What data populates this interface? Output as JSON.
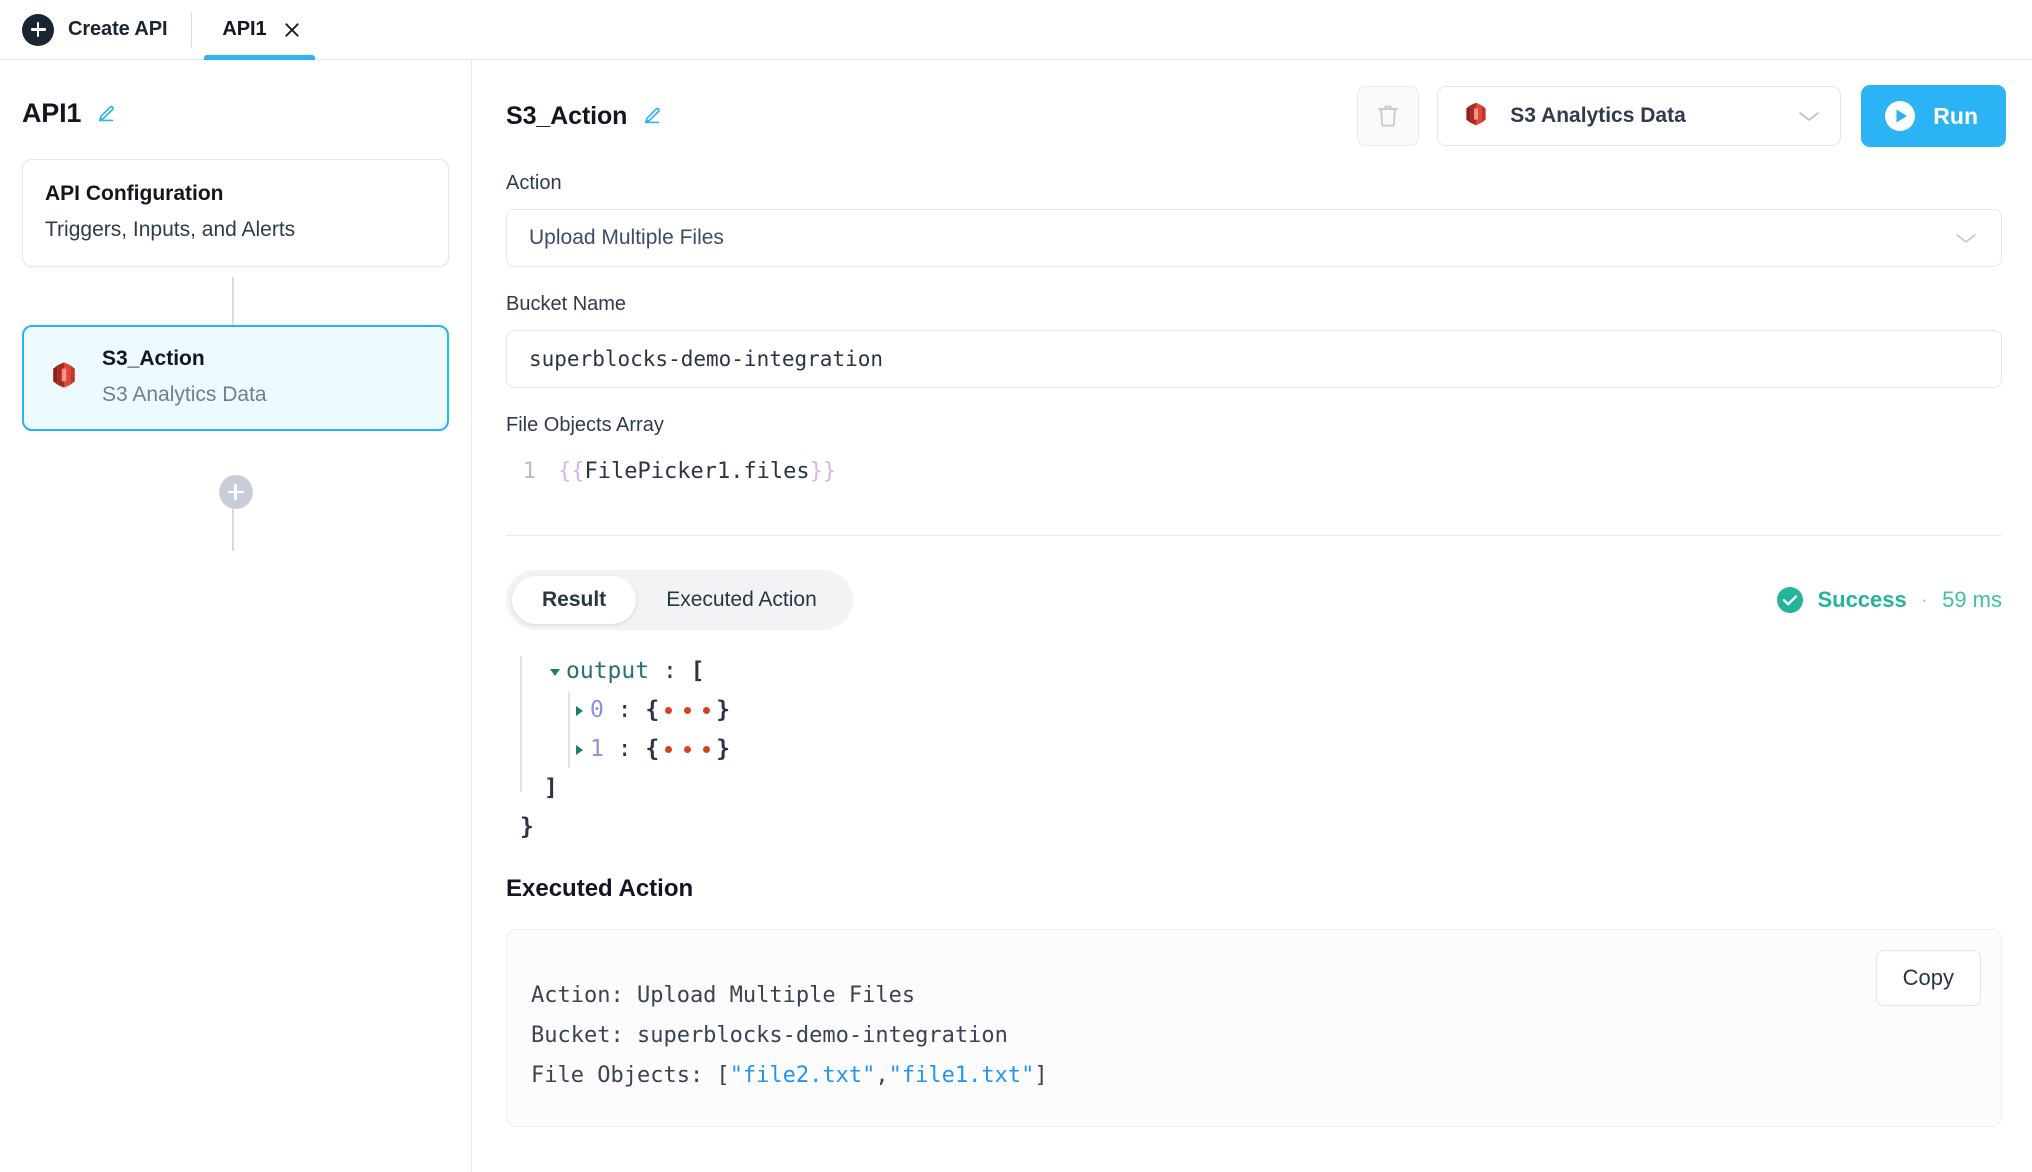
{
  "topbar": {
    "create_api_label": "Create API",
    "plus_icon": "plus-icon",
    "tabs": [
      {
        "label": "API1",
        "active": true,
        "close_icon": "close-icon"
      }
    ]
  },
  "sidebar": {
    "api_name": "API1",
    "edit_icon": "pencil-icon",
    "nodes": [
      {
        "title": "API Configuration",
        "subtitle": "Triggers, Inputs, and Alerts",
        "selected": false,
        "icon": null
      },
      {
        "title": "S3_Action",
        "subtitle": "S3 Analytics Data",
        "selected": true,
        "icon": "s3-icon"
      }
    ],
    "add_step_icon": "plus-icon"
  },
  "main": {
    "header": {
      "title": "S3_Action",
      "edit_icon": "pencil-icon",
      "delete_icon": "trash-icon",
      "integration": {
        "icon": "s3-icon",
        "name": "S3 Analytics Data",
        "chevron_icon": "chevron-down-icon"
      },
      "run": {
        "label": "Run",
        "icon": "play-icon",
        "color": "#2bb3f3"
      }
    },
    "form": {
      "action": {
        "label": "Action",
        "value": "Upload Multiple Files",
        "chevron_icon": "chevron-down-icon"
      },
      "bucket": {
        "label": "Bucket Name",
        "value": "superblocks-demo-integration"
      },
      "file_objects_array": {
        "label": "File Objects Array",
        "line_number": "1",
        "open_brace": "{{",
        "expression": "FilePicker1.files",
        "close_brace": "}}"
      }
    },
    "results": {
      "tabs": [
        {
          "label": "Result",
          "active": true
        },
        {
          "label": "Executed Action",
          "active": false
        }
      ],
      "status": {
        "icon": "check-circle-icon",
        "text": "Success",
        "separator": "·",
        "duration": "59 ms",
        "color": "#23b597"
      },
      "json": {
        "root_open": "",
        "rows": [
          {
            "indent": 0,
            "caret": "expanded",
            "key": "output",
            "colon": " : ",
            "value": "["
          },
          {
            "indent": 1,
            "caret": "collapsed",
            "key": "0",
            "colon": " : ",
            "value": "{ • • • }"
          },
          {
            "indent": 1,
            "caret": "collapsed",
            "key": "1",
            "colon": " : ",
            "value": "{ • • • }"
          },
          {
            "indent": 0,
            "caret": "none",
            "key": "",
            "colon": "",
            "value": "]"
          },
          {
            "indent": -1,
            "caret": "none",
            "key": "",
            "colon": "",
            "value": "}"
          }
        ]
      },
      "executed_action": {
        "heading": "Executed Action",
        "copy_label": "Copy",
        "lines": [
          {
            "text": "Action: Upload Multiple Files"
          },
          {
            "text": "Bucket: superblocks-demo-integration"
          },
          {
            "prefix": "File Objects: [",
            "strings": [
              "\"file2.txt\"",
              "\"file1.txt\""
            ],
            "separator": ",",
            "suffix": "]"
          }
        ]
      }
    }
  },
  "colors": {
    "accent": "#2bb3f3",
    "success": "#23b597",
    "s3_red": "#c8342a",
    "selected_bg": "#edfaff",
    "border": "#e8eaed"
  }
}
